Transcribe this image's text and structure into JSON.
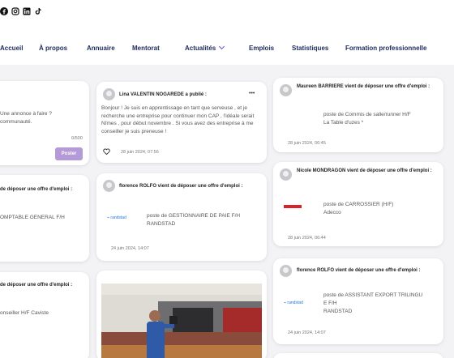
{
  "social": [
    "facebook-icon",
    "instagram-icon",
    "linkedin-icon",
    "tiktok-icon"
  ],
  "nav": {
    "items": [
      "Accueil",
      "À propos",
      "Annuaire",
      "Mentorat",
      "Actualités",
      "Emplois",
      "Statistiques",
      "Formation professionnelle"
    ]
  },
  "composer": {
    "placeholder_line1": "Une annonce à faire ?",
    "placeholder_line2": "communauté.",
    "counter": "0/500",
    "post_button": "Poster"
  },
  "left_cards": [
    {
      "header": "de déposer une offre d'emploi :",
      "offer": "OMPTABLE GENERAL F/H"
    },
    {
      "header": "de déposer une offre d'emploi :",
      "offer": "onseiller H/F Caviste"
    }
  ],
  "middle": {
    "post": {
      "author": "Lina VALENTIN NOGAREDE a publié :",
      "menu": "•••",
      "text": "Bonjour ! Je suis en apprentissage en tant que serveuse , et je recherche une entreprise pour continuer mon CAP , l'idéale serait Nîmes , pour début novembre . Si vous avez des entreprise à me conseiller je suis preneuse !",
      "date": "28 juin 2024, 07:56"
    },
    "offer": {
      "author": "florence ROLFO vient de déposer une offre d'emploi :",
      "logo": "randstad",
      "title": "poste de GESTIONNAIRE DE PAIE F/H",
      "company": "RANDSTAD",
      "date": "24 juin 2024, 14:07"
    }
  },
  "right": [
    {
      "author": "Maureen BARRIERE vient de déposer une offre d'emploi :",
      "title": "poste de Commis de salle/runner H/F",
      "company": "La Table d'uzes *",
      "date": "28 juin 2024, 06:45"
    },
    {
      "author": "Nicole MONDRAGON vient de déposer une offre d'emploi :",
      "logo": "Adecco",
      "title": "poste de CARROSSIER (H/F)",
      "company": "Adecco",
      "date": "28 juin 2024, 06:44"
    },
    {
      "author": "florence ROLFO vient de déposer une offre d'emploi :",
      "logo": "randstad",
      "title_line1": "poste de ASSISTANT EXPORT TRILINGU",
      "title_line2": "E F/H",
      "company": "RANDSTAD",
      "date": "24 juin 2024, 14:07"
    }
  ]
}
